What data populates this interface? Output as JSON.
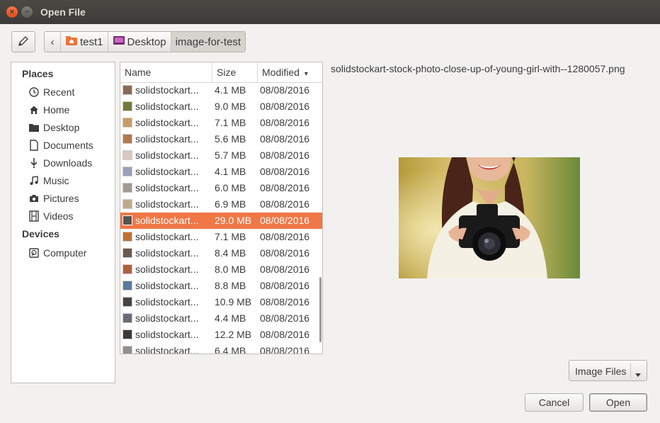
{
  "window": {
    "title": "Open File",
    "close_glyph": "×",
    "minimize_glyph": "−"
  },
  "breadcrumb": {
    "back_glyph": "‹",
    "items": [
      {
        "label": "test1",
        "icon": "home-folder-icon"
      },
      {
        "label": "Desktop",
        "icon": "desktop-folder-icon"
      },
      {
        "label": "image-for-test",
        "icon": ""
      }
    ]
  },
  "places": {
    "heading": "Places",
    "items": [
      {
        "label": "Recent",
        "icon": "clock-icon"
      },
      {
        "label": "Home",
        "icon": "home-icon"
      },
      {
        "label": "Desktop",
        "icon": "folder-icon"
      },
      {
        "label": "Documents",
        "icon": "document-icon"
      },
      {
        "label": "Downloads",
        "icon": "download-icon"
      },
      {
        "label": "Music",
        "icon": "music-icon"
      },
      {
        "label": "Pictures",
        "icon": "camera-icon"
      },
      {
        "label": "Videos",
        "icon": "film-icon"
      }
    ],
    "devices_heading": "Devices",
    "devices": [
      {
        "label": "Computer",
        "icon": "harddisk-icon"
      }
    ]
  },
  "file_list": {
    "columns": {
      "name": "Name",
      "size": "Size",
      "modified": "Modified"
    },
    "sort_glyph": "▾",
    "rows": [
      {
        "name": "solidstockart...",
        "size": "4.1 MB",
        "modified": "08/08/2016",
        "thumb": "#8a6a55"
      },
      {
        "name": "solidstockart...",
        "size": "9.0 MB",
        "modified": "08/08/2016",
        "thumb": "#6f7a3a"
      },
      {
        "name": "solidstockart...",
        "size": "7.1 MB",
        "modified": "08/08/2016",
        "thumb": "#c89a6a"
      },
      {
        "name": "solidstockart...",
        "size": "5.6 MB",
        "modified": "08/08/2016",
        "thumb": "#b07850"
      },
      {
        "name": "solidstockart...",
        "size": "5.7 MB",
        "modified": "08/08/2016",
        "thumb": "#d8c8c0"
      },
      {
        "name": "solidstockart...",
        "size": "4.1 MB",
        "modified": "08/08/2016",
        "thumb": "#9aa0b8"
      },
      {
        "name": "solidstockart...",
        "size": "6.0 MB",
        "modified": "08/08/2016",
        "thumb": "#a09a90"
      },
      {
        "name": "solidstockart...",
        "size": "6.9 MB",
        "modified": "08/08/2016",
        "thumb": "#c0a890"
      },
      {
        "name": "solidstockart...",
        "size": "29.0 MB",
        "modified": "08/08/2016",
        "thumb": "#555555",
        "selected": true
      },
      {
        "name": "solidstockart...",
        "size": "7.1 MB",
        "modified": "08/08/2016",
        "thumb": "#c07030"
      },
      {
        "name": "solidstockart...",
        "size": "8.4 MB",
        "modified": "08/08/2016",
        "thumb": "#6a5a50"
      },
      {
        "name": "solidstockart...",
        "size": "8.0 MB",
        "modified": "08/08/2016",
        "thumb": "#b06040"
      },
      {
        "name": "solidstockart...",
        "size": "8.8 MB",
        "modified": "08/08/2016",
        "thumb": "#5a7a9a"
      },
      {
        "name": "solidstockart...",
        "size": "10.9 MB",
        "modified": "08/08/2016",
        "thumb": "#444444"
      },
      {
        "name": "solidstockart...",
        "size": "4.4 MB",
        "modified": "08/08/2016",
        "thumb": "#6a6a7a"
      },
      {
        "name": "solidstockart...",
        "size": "12.2 MB",
        "modified": "08/08/2016",
        "thumb": "#3a3a3a"
      },
      {
        "name": "solidstockart...",
        "size": "6.4 MB",
        "modified": "08/08/2016",
        "thumb": "#909090"
      }
    ]
  },
  "preview": {
    "filename": "solidstockart-stock-photo-close-up-of-young-girl-with--1280057.png"
  },
  "filter": {
    "label": "Image Files",
    "arrow": "▾"
  },
  "buttons": {
    "cancel": "Cancel",
    "open": "Open"
  },
  "colors": {
    "accent": "#f07746",
    "titlebar": "#3c3b37"
  }
}
